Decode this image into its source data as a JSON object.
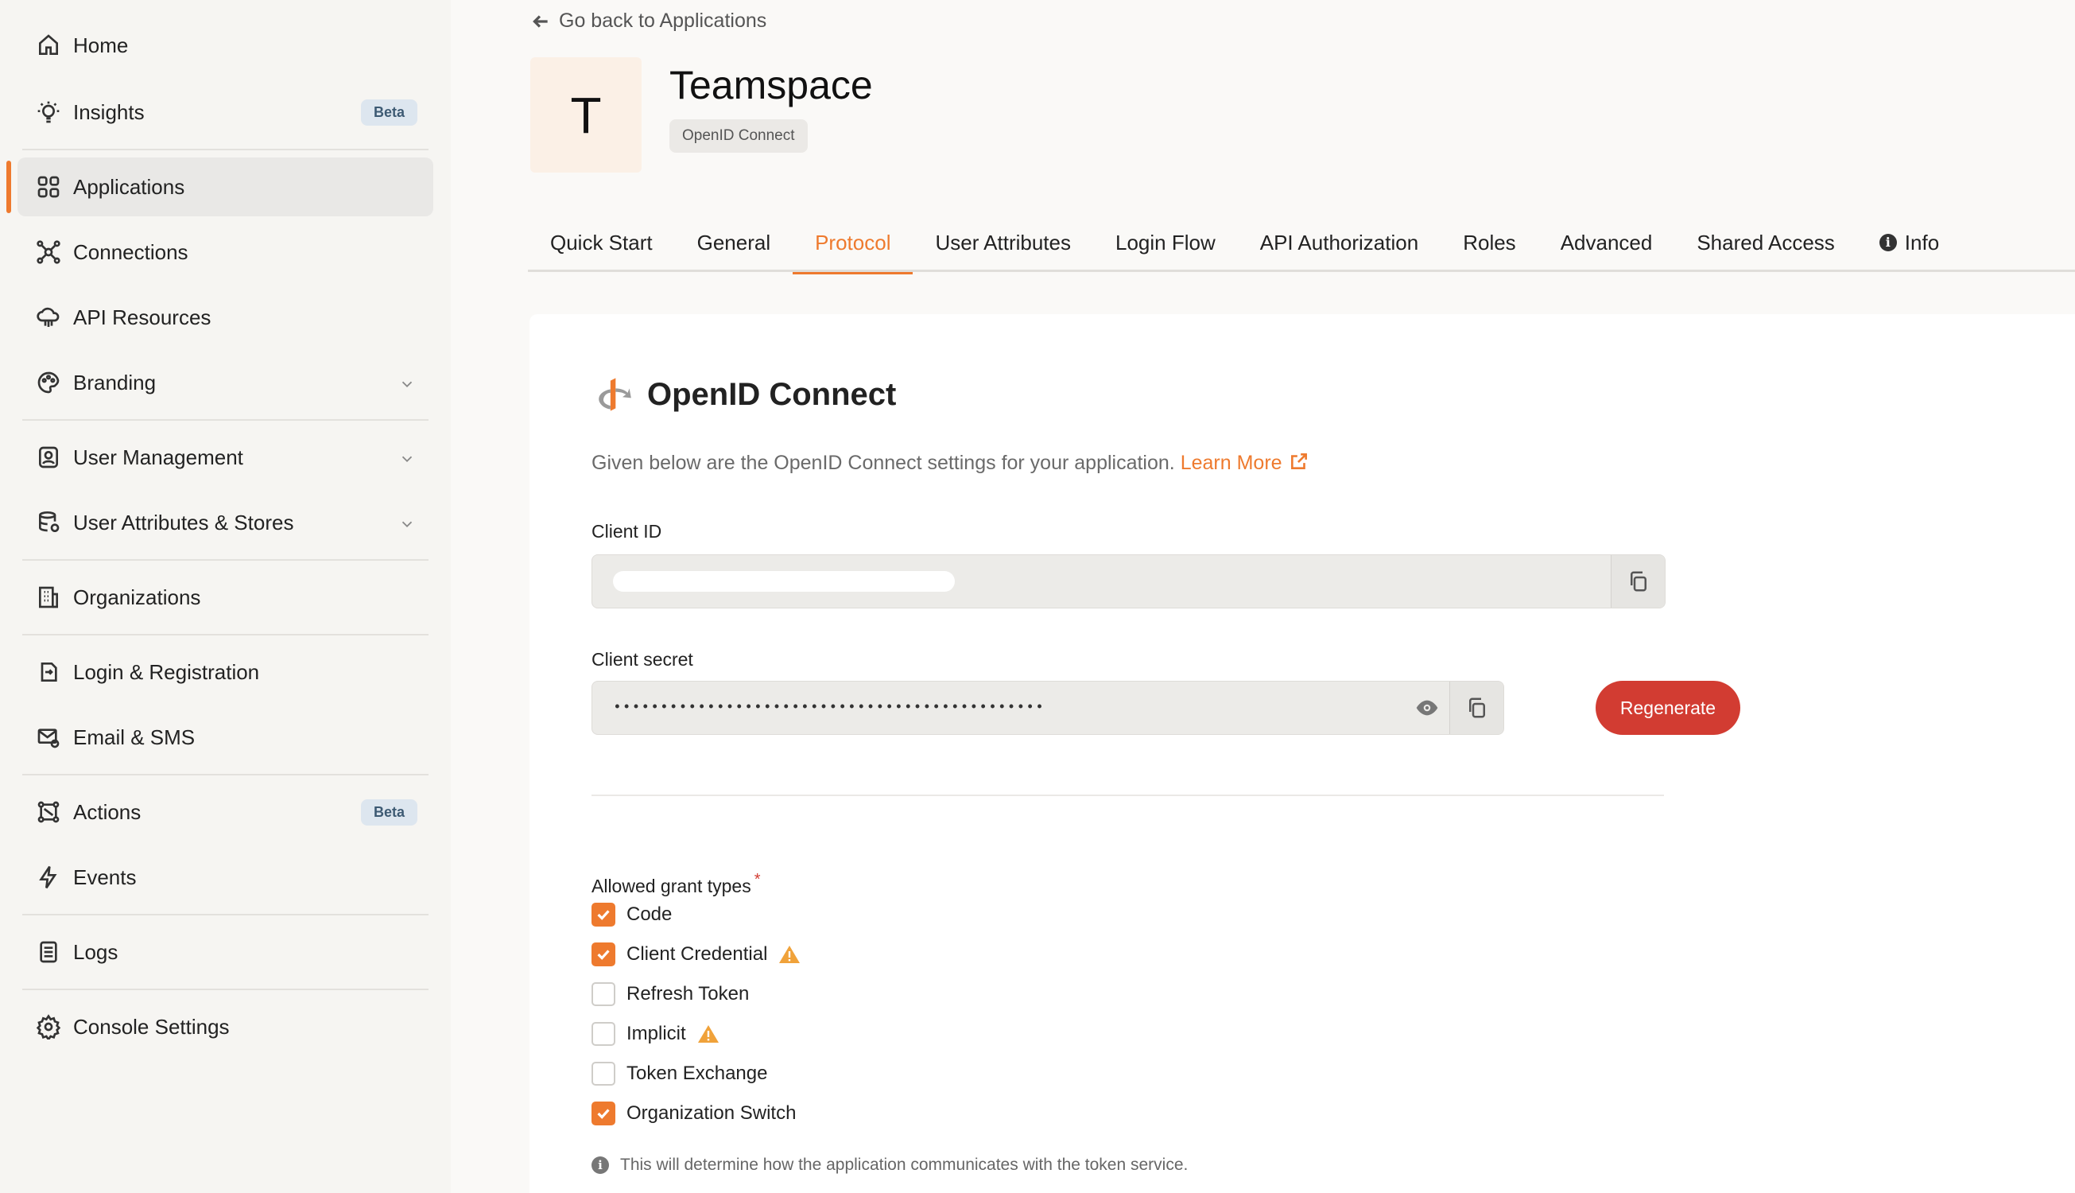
{
  "sidebar": {
    "items": [
      {
        "label": "Home",
        "icon": "home-icon"
      },
      {
        "label": "Insights",
        "icon": "bulb-icon",
        "badge": "Beta"
      },
      {
        "label": "Applications",
        "icon": "grid-icon",
        "active": true
      },
      {
        "label": "Connections",
        "icon": "connections-icon"
      },
      {
        "label": "API Resources",
        "icon": "cloud-icon"
      },
      {
        "label": "Branding",
        "icon": "palette-icon",
        "expandable": true
      },
      {
        "label": "User Management",
        "icon": "user-card-icon",
        "expandable": true
      },
      {
        "label": "User Attributes & Stores",
        "icon": "database-icon",
        "expandable": true
      },
      {
        "label": "Organizations",
        "icon": "building-icon"
      },
      {
        "label": "Login & Registration",
        "icon": "login-icon"
      },
      {
        "label": "Email & SMS",
        "icon": "mail-gear-icon"
      },
      {
        "label": "Actions",
        "icon": "actions-icon",
        "badge": "Beta"
      },
      {
        "label": "Events",
        "icon": "bolt-icon"
      },
      {
        "label": "Logs",
        "icon": "document-icon"
      },
      {
        "label": "Console Settings",
        "icon": "gear-icon"
      }
    ]
  },
  "header": {
    "back_label": "Go back to Applications",
    "avatar_letter": "T",
    "app_name": "Teamspace",
    "protocol_chip": "OpenID Connect"
  },
  "tabs": [
    {
      "label": "Quick Start"
    },
    {
      "label": "General"
    },
    {
      "label": "Protocol",
      "active": true
    },
    {
      "label": "User Attributes"
    },
    {
      "label": "Login Flow"
    },
    {
      "label": "API Authorization"
    },
    {
      "label": "Roles"
    },
    {
      "label": "Advanced"
    },
    {
      "label": "Shared Access"
    },
    {
      "label": "Info"
    }
  ],
  "protocol": {
    "title": "OpenID Connect",
    "description": "Given below are the OpenID Connect settings for your application.",
    "learn_more": "Learn More",
    "client_id_label": "Client ID",
    "client_secret_label": "Client secret",
    "client_secret_masked": "••••••••••••••••••••••••••••••••••••••••••••••",
    "regenerate_label": "Regenerate",
    "grant_types_label": "Allowed grant types",
    "required_marker": "*",
    "grant_types": [
      {
        "label": "Code",
        "checked": true,
        "warning": false
      },
      {
        "label": "Client Credential",
        "checked": true,
        "warning": true
      },
      {
        "label": "Refresh Token",
        "checked": false,
        "warning": false
      },
      {
        "label": "Implicit",
        "checked": false,
        "warning": true
      },
      {
        "label": "Token Exchange",
        "checked": false,
        "warning": false
      },
      {
        "label": "Organization Switch",
        "checked": true,
        "warning": false
      }
    ],
    "hint": "This will determine how the application communicates with the token service."
  },
  "colors": {
    "accent": "#ee7a2e",
    "danger": "#d23c32",
    "warning": "#f0a23a"
  }
}
